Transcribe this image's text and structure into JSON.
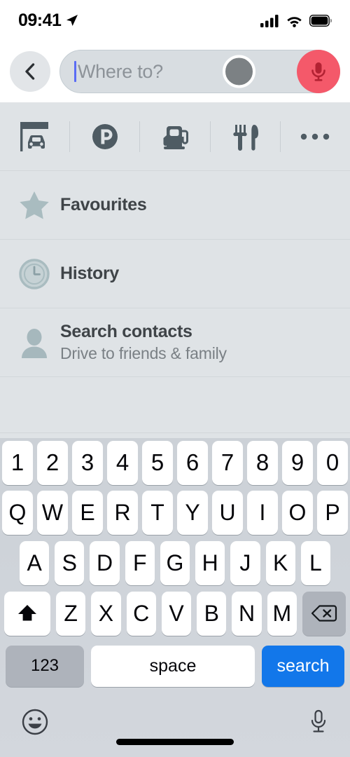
{
  "status_bar": {
    "time": "09:41",
    "location_icon": "location-arrow-icon",
    "signal_icon": "cellular-signal-icon",
    "wifi_icon": "wifi-icon",
    "battery_icon": "battery-full-icon"
  },
  "header": {
    "back_icon": "chevron-left-icon",
    "search_placeholder": "Where to?",
    "search_value": "",
    "mic_icon": "microphone-icon",
    "mic_color": "#f4596a",
    "touch_indicator": "touch-point-indicator"
  },
  "categories": [
    {
      "name": "car-canopy-icon",
      "label": "Car services"
    },
    {
      "name": "parking-icon",
      "label": "Parking"
    },
    {
      "name": "gas-pump-icon",
      "label": "Fuel"
    },
    {
      "name": "restaurant-icon",
      "label": "Restaurants"
    },
    {
      "name": "more-ellipsis-icon",
      "label": "More"
    }
  ],
  "list": [
    {
      "icon": "star-icon",
      "title": "Favourites",
      "subtitle": ""
    },
    {
      "icon": "clock-icon",
      "title": "History",
      "subtitle": ""
    },
    {
      "icon": "person-icon",
      "title": "Search contacts",
      "subtitle": "Drive to friends & family"
    }
  ],
  "keyboard": {
    "row_numbers": [
      "1",
      "2",
      "3",
      "4",
      "5",
      "6",
      "7",
      "8",
      "9",
      "0"
    ],
    "row_top": [
      "Q",
      "W",
      "E",
      "R",
      "T",
      "Y",
      "U",
      "I",
      "O",
      "P"
    ],
    "row_home": [
      "A",
      "S",
      "D",
      "F",
      "G",
      "H",
      "J",
      "K",
      "L"
    ],
    "row_bottom": [
      "Z",
      "X",
      "C",
      "V",
      "B",
      "N",
      "M"
    ],
    "shift_icon": "shift-arrow-icon",
    "backspace_icon": "backspace-delete-icon",
    "numeric_label": "123",
    "space_label": "space",
    "return_label": "search",
    "return_color": "#1277ea",
    "emoji_icon": "emoji-smiley-icon",
    "dictation_icon": "dictation-microphone-icon"
  }
}
